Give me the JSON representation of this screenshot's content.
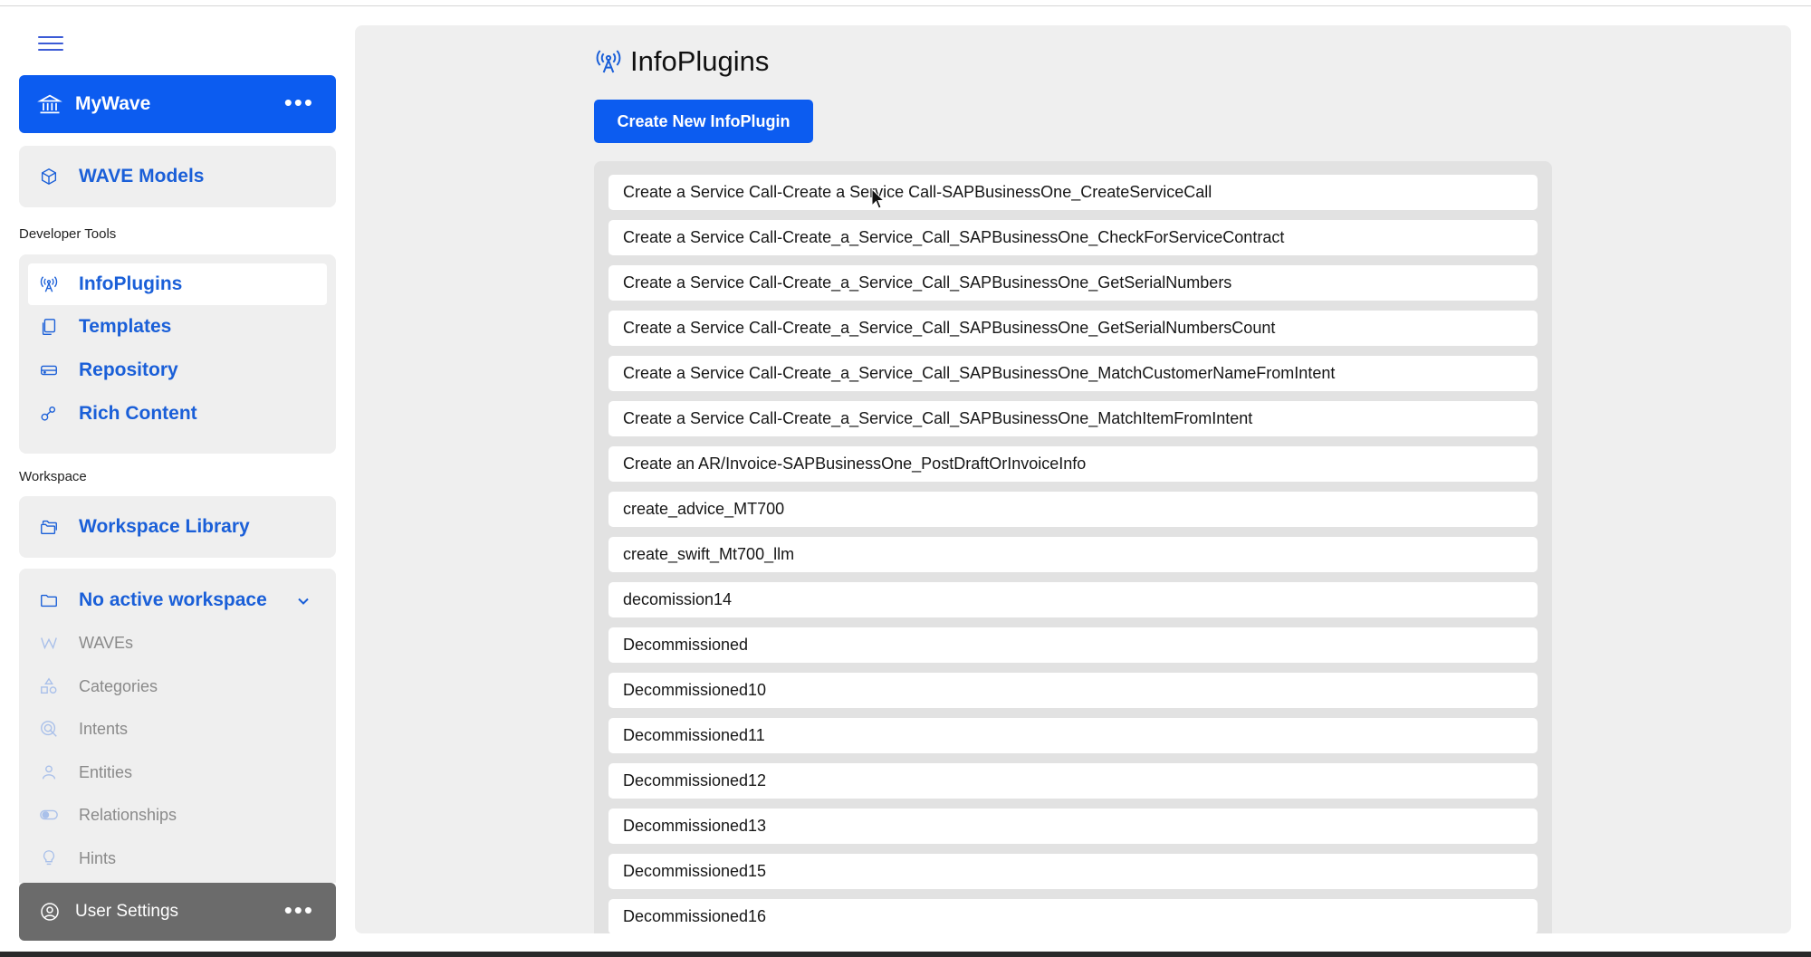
{
  "brand": {
    "label": "MyWave",
    "menu": "•••"
  },
  "nav_top": {
    "wave_models": "WAVE Models"
  },
  "sections": {
    "developer_tools": "Developer Tools",
    "workspace": "Workspace"
  },
  "dev_tools": [
    {
      "label": "InfoPlugins",
      "icon": "antenna-icon",
      "active": true
    },
    {
      "label": "Templates",
      "icon": "copy-icon",
      "active": false
    },
    {
      "label": "Repository",
      "icon": "drive-icon",
      "active": false
    },
    {
      "label": "Rich Content",
      "icon": "shapes-icon",
      "active": false
    }
  ],
  "workspace": {
    "library": "Workspace Library",
    "active": "No active workspace",
    "items": [
      {
        "label": "WAVEs",
        "icon": "wave-icon"
      },
      {
        "label": "Categories",
        "icon": "categories-icon"
      },
      {
        "label": "Intents",
        "icon": "target-icon"
      },
      {
        "label": "Entities",
        "icon": "person-icon"
      },
      {
        "label": "Relationships",
        "icon": "toggle-icon"
      },
      {
        "label": "Hints",
        "icon": "lightbulb-icon"
      }
    ]
  },
  "user_settings": {
    "label": "User Settings",
    "menu": "•••"
  },
  "main": {
    "title": "InfoPlugins",
    "create_button": "Create New InfoPlugin",
    "items": [
      "Create a Service Call-Create a Service Call-SAPBusinessOne_CreateServiceCall",
      "Create a Service Call-Create_a_Service_Call_SAPBusinessOne_CheckForServiceContract",
      "Create a Service Call-Create_a_Service_Call_SAPBusinessOne_GetSerialNumbers",
      "Create a Service Call-Create_a_Service_Call_SAPBusinessOne_GetSerialNumbersCount",
      "Create a Service Call-Create_a_Service_Call_SAPBusinessOne_MatchCustomerNameFromIntent",
      "Create a Service Call-Create_a_Service_Call_SAPBusinessOne_MatchItemFromIntent",
      "Create an AR/Invoice-SAPBusinessOne_PostDraftOrInvoiceInfo",
      "create_advice_MT700",
      "create_swift_Mt700_llm",
      "decomission14",
      "Decommissioned",
      "Decommissioned10",
      "Decommissioned11",
      "Decommissioned12",
      "Decommissioned13",
      "Decommissioned15",
      "Decommissioned16"
    ]
  },
  "colors": {
    "accent": "#0c5cf0",
    "link": "#1a5fd8",
    "panel": "#efefef",
    "user_settings_bg": "#6b6b6b"
  }
}
